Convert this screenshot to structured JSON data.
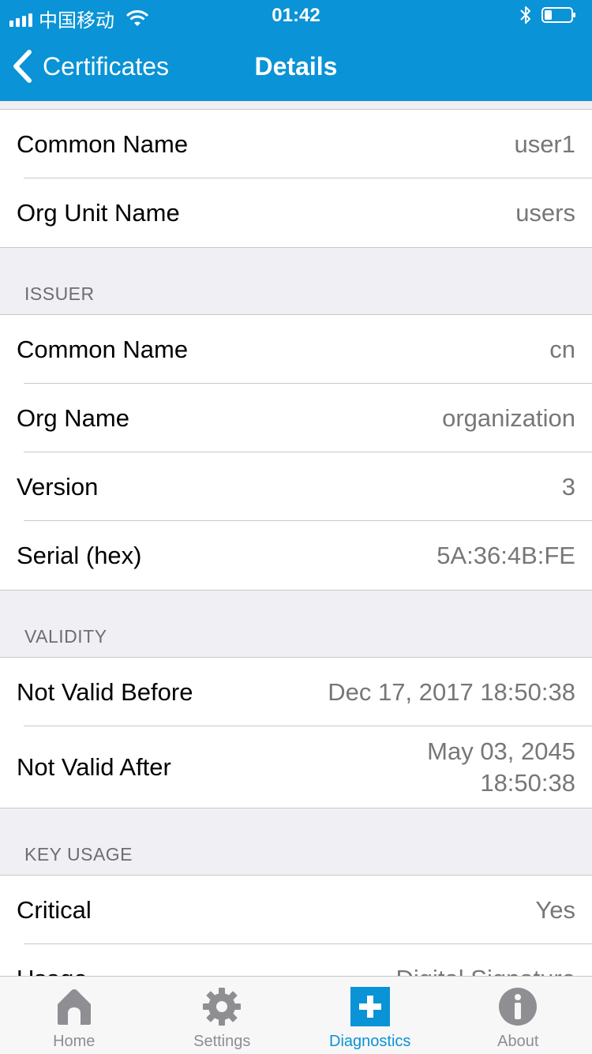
{
  "status_bar": {
    "carrier": "中国移动",
    "time": "01:42"
  },
  "nav": {
    "back_label": "Certificates",
    "title": "Details"
  },
  "subject": {
    "rows": [
      {
        "label": "Common Name",
        "value": "user1"
      },
      {
        "label": "Org Unit Name",
        "value": "users"
      }
    ]
  },
  "issuer": {
    "header": "ISSUER",
    "rows": [
      {
        "label": "Common Name",
        "value": "cn"
      },
      {
        "label": "Org Name",
        "value": "organization"
      },
      {
        "label": "Version",
        "value": "3"
      },
      {
        "label": "Serial (hex)",
        "value": "5A:36:4B:FE"
      }
    ]
  },
  "validity": {
    "header": "VALIDITY",
    "not_before": {
      "label": "Not Valid Before",
      "value": "Dec 17, 2017 18:50:38"
    },
    "not_after": {
      "label": "Not Valid After",
      "value_line1": "May 03, 2045",
      "value_line2": "18:50:38"
    }
  },
  "key_usage": {
    "header": "KEY USAGE",
    "rows": [
      {
        "label": "Critical",
        "value": "Yes"
      },
      {
        "label": "Usage",
        "value": "Digital Signature"
      }
    ]
  },
  "tabs": [
    {
      "label": "Home",
      "icon": "home-icon"
    },
    {
      "label": "Settings",
      "icon": "gear-icon"
    },
    {
      "label": "Diagnostics",
      "icon": "plus-icon",
      "active": true
    },
    {
      "label": "About",
      "icon": "info-icon"
    }
  ],
  "colors": {
    "accent": "#0a93d6",
    "inactive": "#8e8e93",
    "value_text": "#777777"
  }
}
